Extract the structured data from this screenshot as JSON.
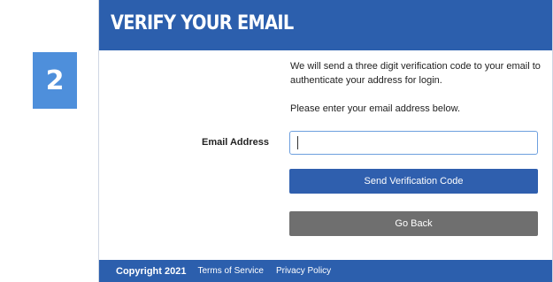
{
  "step": {
    "number": "2"
  },
  "header": {
    "title": "VERIFY YOUR EMAIL"
  },
  "main": {
    "intro": "We will send a three digit verification code to your email to authenticate your address for login.",
    "prompt": "Please enter your email address below.",
    "email": {
      "label": "Email Address",
      "value": "",
      "placeholder": ""
    },
    "send_button_label": "Send Verification Code",
    "back_button_label": "Go Back"
  },
  "footer": {
    "copyright": "Copyright 2021",
    "links": [
      "Terms of Service",
      "Privacy Policy"
    ]
  },
  "colors": {
    "header_blue": "#2c5fad",
    "badge_blue": "#4e8fdb",
    "send_button": "#2f5fae",
    "back_button": "#6f6f6f",
    "input_border": "#6d9fde"
  }
}
